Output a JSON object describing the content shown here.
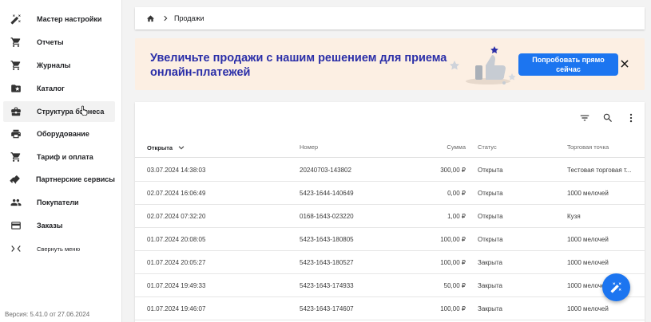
{
  "sidebar": {
    "items": [
      {
        "label": "Мастер настройки",
        "icon": "magic-wand-icon"
      },
      {
        "label": "Отчеты",
        "icon": "cart-icon"
      },
      {
        "label": "Журналы",
        "icon": "cart-icon"
      },
      {
        "label": "Каталог",
        "icon": "folder-star-icon"
      },
      {
        "label": "Структура бизнеса",
        "icon": "briefcase-icon"
      },
      {
        "label": "Оборудование",
        "icon": "printer-icon"
      },
      {
        "label": "Тариф и оплата",
        "icon": "cart-icon"
      },
      {
        "label": "Партнерские сервисы",
        "icon": "handshake-icon"
      },
      {
        "label": "Покупатели",
        "icon": "people-icon"
      },
      {
        "label": "Заказы",
        "icon": "credit-card-icon"
      }
    ],
    "collapse_label": "Свернуть меню",
    "version": "Версия: 5.41.0 от 27.06.2024"
  },
  "breadcrumb": {
    "current": "Продажи"
  },
  "banner": {
    "title": "Увеличьте продажи с нашим решением для приема онлайн-платежей",
    "cta": "Попробовать прямо сейчас"
  },
  "table": {
    "headers": {
      "opened": "Открыта",
      "number": "Номер",
      "sum": "Сумма",
      "status": "Статус",
      "point": "Торговая точка"
    },
    "rows": [
      {
        "opened": "03.07.2024 14:38:03",
        "number": "20240703-143802",
        "sum": "300,00 ₽",
        "status": "Открыта",
        "point": "Тестовая торговая т..."
      },
      {
        "opened": "02.07.2024 16:06:49",
        "number": "5423-1644-140649",
        "sum": "0,00 ₽",
        "status": "Открыта",
        "point": "1000 мелочей"
      },
      {
        "opened": "02.07.2024 07:32:20",
        "number": "0168-1643-023220",
        "sum": "1,00 ₽",
        "status": "Открыта",
        "point": "Кузя"
      },
      {
        "opened": "01.07.2024 20:08:05",
        "number": "5423-1643-180805",
        "sum": "100,00 ₽",
        "status": "Открыта",
        "point": "1000 мелочей"
      },
      {
        "opened": "01.07.2024 20:05:27",
        "number": "5423-1643-180527",
        "sum": "100,00 ₽",
        "status": "Закрыта",
        "point": "1000 мелочей"
      },
      {
        "opened": "01.07.2024 19:49:33",
        "number": "5423-1643-174933",
        "sum": "50,00 ₽",
        "status": "Закрыта",
        "point": "1000 мелочей"
      },
      {
        "opened": "01.07.2024 19:46:07",
        "number": "5423-1643-174607",
        "sum": "100,00 ₽",
        "status": "Закрыта",
        "point": "1000 мелочей"
      }
    ]
  },
  "colors": {
    "accent": "#1c75f0",
    "banner_bg": "#fcefe3",
    "banner_title": "#2a2ea8"
  }
}
